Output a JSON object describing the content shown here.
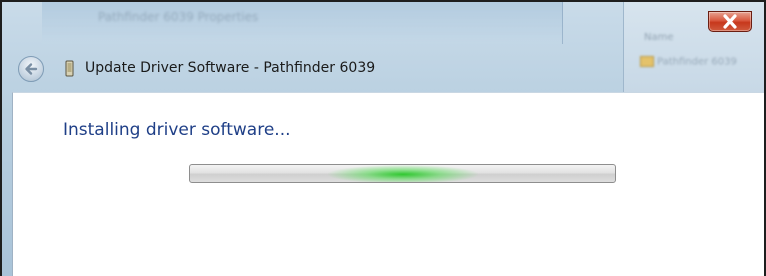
{
  "window": {
    "title": "Update Driver Software - Pathfinder 6039",
    "background_window_title": "Pathfinder 6039 Properties",
    "background_panel_label": "Name",
    "background_panel_item": "Pathfinder 6039",
    "close_symbol": "x"
  },
  "content": {
    "heading": "Installing driver software..."
  },
  "progress": {
    "state": "indeterminate (marquee)",
    "glow_position_fraction": 0.5,
    "glow_color": "#2ec82e"
  },
  "icons": {
    "back": "back-arrow-icon",
    "device": "device-icon",
    "close": "close-icon"
  },
  "colors": {
    "heading": "#1f3f87",
    "close_button": "#d9593f",
    "title_bar": "#b8cfe0"
  }
}
